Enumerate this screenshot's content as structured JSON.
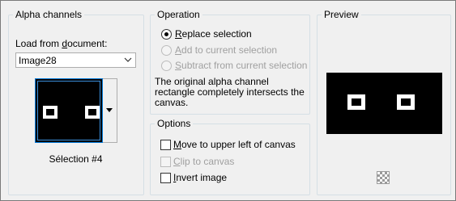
{
  "alpha_channels": {
    "title": "Alpha channels",
    "load_label_prefix": "Load from ",
    "load_label_underlined": "d",
    "load_label_suffix": "ocument:",
    "document_value": "Image28",
    "selection_name": "Sélection #4"
  },
  "operation": {
    "title": "Operation",
    "options": [
      {
        "underlined": "R",
        "rest": "eplace selection",
        "selected": true,
        "enabled": true
      },
      {
        "underlined": "A",
        "rest": "dd to current selection",
        "selected": false,
        "enabled": false
      },
      {
        "underlined": "S",
        "rest": "ubtract from current selection",
        "selected": false,
        "enabled": false
      }
    ],
    "description_line1": "The original alpha channel",
    "description_line2": "rectangle completely intersects the",
    "description_line3": "canvas."
  },
  "options": {
    "title": "Options",
    "items": [
      {
        "underlined": "M",
        "rest": "ove to upper left of canvas",
        "checked": false,
        "enabled": true
      },
      {
        "underlined": "C",
        "rest": "lip to canvas",
        "checked": false,
        "enabled": false
      },
      {
        "underlined": "I",
        "rest": "nvert image",
        "checked": false,
        "enabled": true
      }
    ]
  },
  "preview": {
    "title": "Preview",
    "zoom_icon": "checkerboard-icon"
  }
}
